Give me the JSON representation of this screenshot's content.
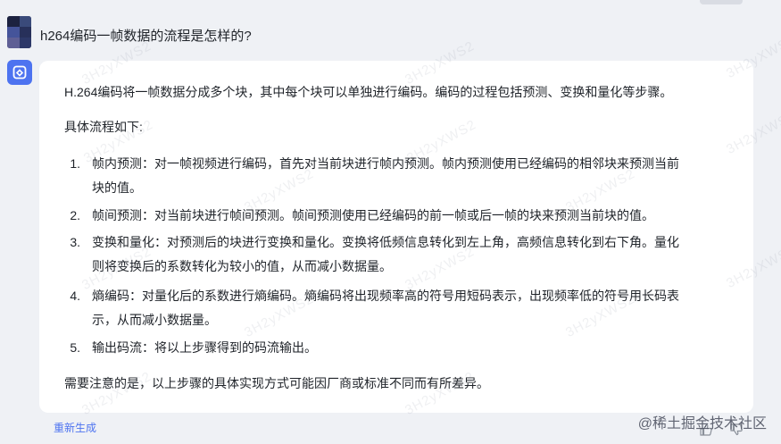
{
  "conversation": {
    "question": "h264编码一帧数据的流程是怎样的?",
    "answer": {
      "intro": "H.264编码将一帧数据分成多个块，其中每个块可以单独进行编码。编码的过程包括预测、变换和量化等步骤。",
      "flow_title": "具体流程如下:",
      "steps": [
        {
          "num": "1.",
          "line1": "帧内预测：对一帧视频进行编码，首先对当前块进行帧内预测。帧内预测使用已经编码的相邻块来预测当前",
          "line2": "块的值。"
        },
        {
          "num": "2.",
          "line1": "帧间预测：对当前块进行帧间预测。帧间预测使用已经编码的前一帧或后一帧的块来预测当前块的值。",
          "line2": ""
        },
        {
          "num": "3.",
          "line1": "变换和量化：对预测后的块进行变换和量化。变换将低频信息转化到左上角，高频信息转化到右下角。量化",
          "line2": "则将变换后的系数转化为较小的值，从而减小数据量。"
        },
        {
          "num": "4.",
          "line1": "熵编码：对量化后的系数进行熵编码。熵编码将出现频率高的符号用短码表示，出现频率低的符号用长码表",
          "line2": "示，从而减小数据量。"
        },
        {
          "num": "5.",
          "line1": "输出码流：将以上步骤得到的码流输出。",
          "line2": ""
        }
      ],
      "note": "需要注意的是，以上步骤的具体实现方式可能因厂商或标准不同而有所差异。"
    },
    "regenerate_label": "重新生成"
  },
  "watermark": {
    "text": "3H2yXWS2"
  },
  "site_credit": "@稀土掘金技术社区",
  "colors": {
    "page_bg": "#eff1f5",
    "card_bg": "#ffffff",
    "accent": "#4d73f0",
    "text": "#1f2329"
  },
  "icons": {
    "bot_avatar": "cube-logo-icon",
    "user_avatar": "pixel-avatar-icon",
    "like": "thumbs-up-icon",
    "dislike": "thumbs-down-icon"
  }
}
